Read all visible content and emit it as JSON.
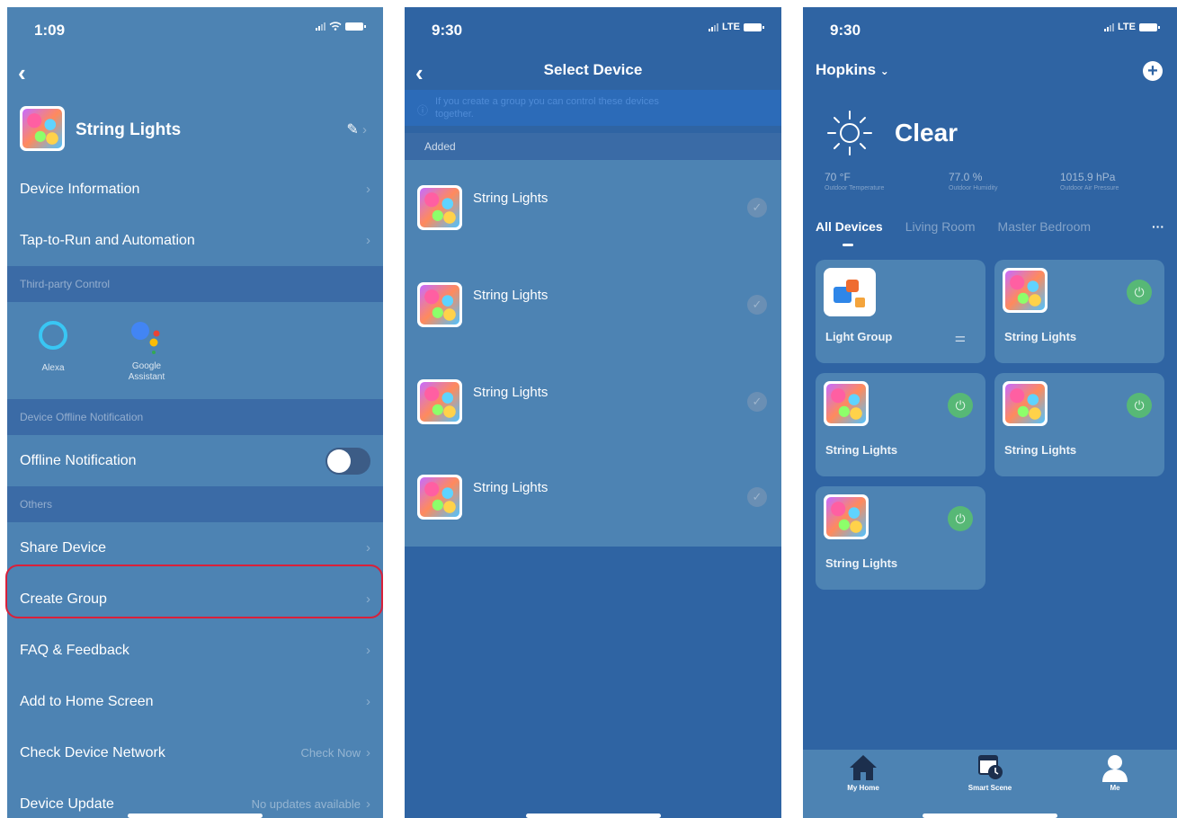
{
  "screen1": {
    "time": "1:09",
    "device_name": "String Lights",
    "rows_top": [
      {
        "label": "Device Information"
      },
      {
        "label": "Tap-to-Run and Automation"
      }
    ],
    "section_third_party": "Third-party Control",
    "alexa_label": "Alexa",
    "google_label": "Google Assistant",
    "section_offline": "Device Offline Notification",
    "offline_label": "Offline Notification",
    "offline_enabled": false,
    "section_others": "Others",
    "rows_others": [
      {
        "label": "Share Device"
      },
      {
        "label": "Create Group"
      },
      {
        "label": "FAQ & Feedback"
      },
      {
        "label": "Add to Home Screen"
      },
      {
        "label": "Check Device Network",
        "value": "Check Now"
      },
      {
        "label": "Device Update",
        "value": "No updates available"
      }
    ]
  },
  "screen2": {
    "time": "9:30",
    "network": "LTE",
    "title": "Select Device",
    "info_text": "If you create a group you can control these devices together.",
    "added_label": "Added",
    "devices": [
      {
        "name": "String Lights"
      },
      {
        "name": "String Lights"
      },
      {
        "name": "String Lights"
      },
      {
        "name": "String Lights"
      }
    ]
  },
  "screen3": {
    "time": "9:30",
    "network": "LTE",
    "home_name": "Hopkins",
    "condition": "Clear",
    "temperature": "70 °F",
    "temperature_label": "Outdoor Temperature",
    "humidity": "77.0 %",
    "humidity_label": "Outdoor Humidity",
    "pressure": "1015.9 hPa",
    "pressure_label": "Outdoor Air Pressure",
    "tabs": [
      "All Devices",
      "Living Room",
      "Master Bedroom"
    ],
    "cards": [
      {
        "name": "Light Group"
      },
      {
        "name": "String Lights"
      },
      {
        "name": "String Lights"
      },
      {
        "name": "String Lights"
      },
      {
        "name": "String Lights"
      }
    ],
    "nav": [
      {
        "label": "My Home"
      },
      {
        "label": "Smart Scene"
      },
      {
        "label": "Me"
      }
    ]
  },
  "colors": {
    "panel": "#4d83b3",
    "dark_bg": "#2f64a3",
    "highlight": "#d9203a",
    "power_on": "#57b876"
  }
}
